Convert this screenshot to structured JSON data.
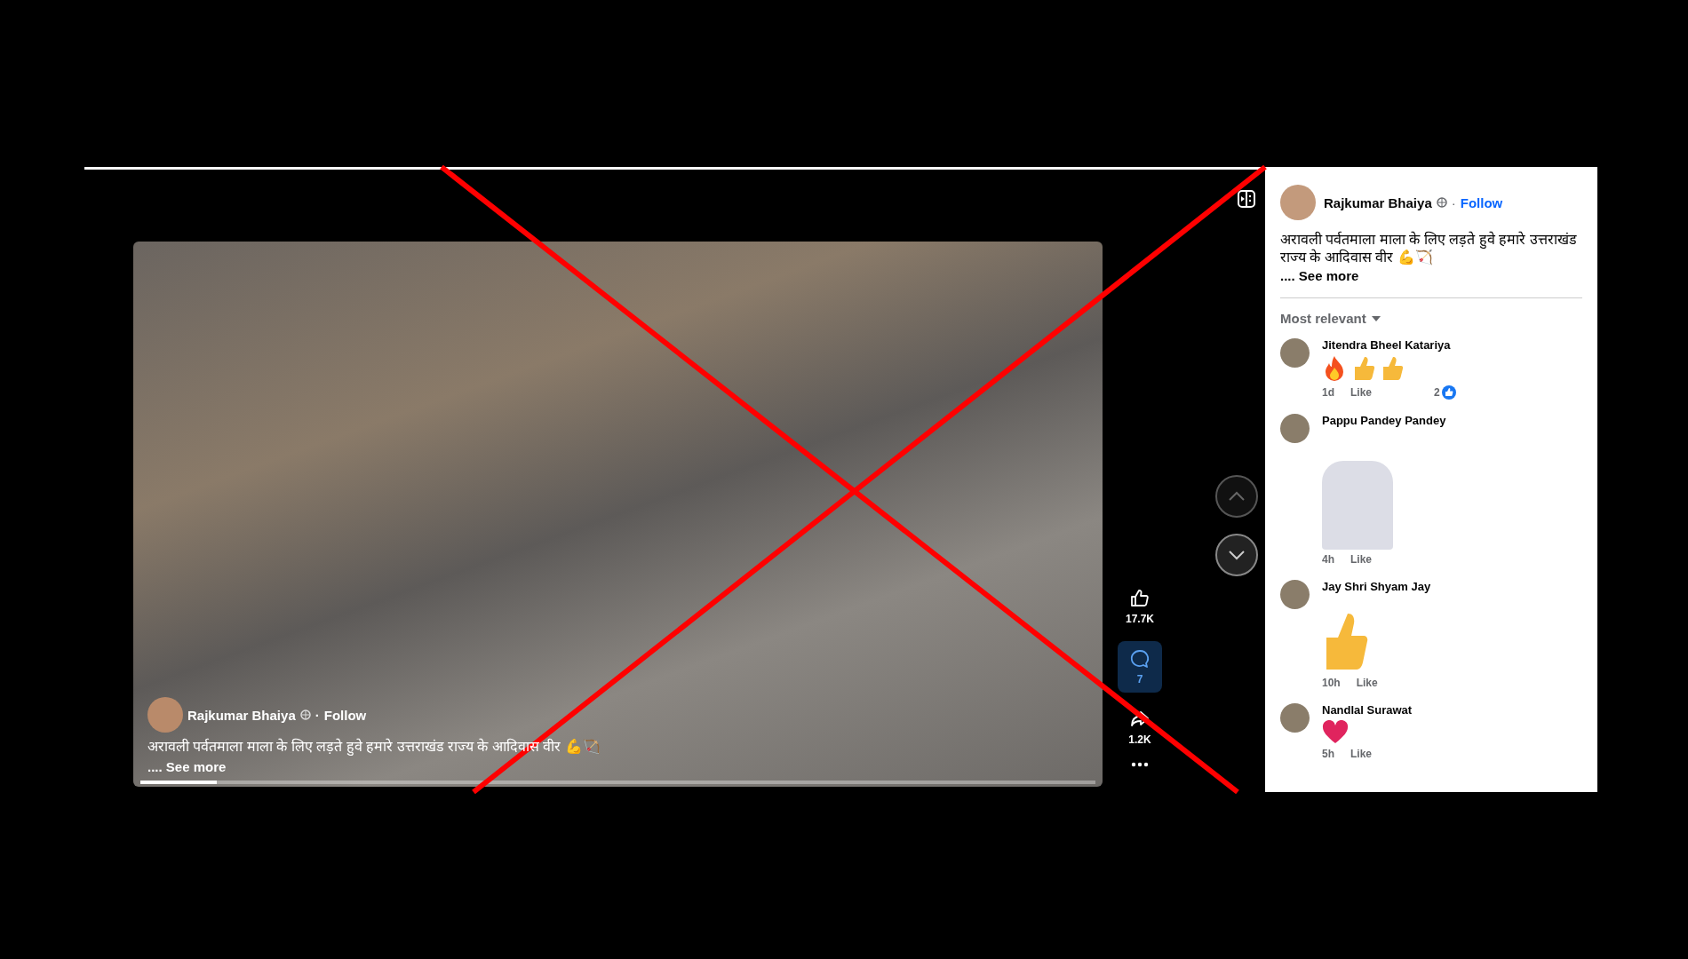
{
  "video": {
    "progress": {
      "level": 0.08
    },
    "author": "Rajkumar Bhaiya",
    "separator": "·",
    "follow": "Follow",
    "caption": "अरावली पर्वतमाला माला के लिए लड़ते हुवे हमारे उत्तराखंड राज्य के आदिवास वीर 💪🏹",
    "see_more": ".... See more"
  },
  "actions": [
    {
      "kind": "like",
      "count": "17.7K",
      "selected": false
    },
    {
      "kind": "comment",
      "count": "7",
      "selected": true
    },
    {
      "kind": "share",
      "count": "1.2K",
      "selected": false
    },
    {
      "kind": "more"
    }
  ],
  "post": {
    "author": "Rajkumar Bhaiya",
    "separator": "·",
    "follow": "Follow",
    "caption": "अरावली पर्वतमाला माला के लिए लड़ते हुवे हमारे उत्तराखंड राज्य के आदिवास वीर 💪🏹",
    "see_more": ".... See more"
  },
  "sort": "Most relevant",
  "comments": [
    {
      "name": "Jitendra Bheel Katariya",
      "content": [
        {
          "kind": "fire"
        },
        {
          "kind": "thumb"
        },
        {
          "kind": "thumb"
        }
      ],
      "time": "1d",
      "like": "Like",
      "reaction_count": "2"
    },
    {
      "name": "Pappu Pandey Pandey",
      "content": [
        {
          "kind": "sticker"
        }
      ],
      "time": "4h",
      "like": "Like"
    },
    {
      "name": "Jay Shri Shyam Jay",
      "content": [
        {
          "kind": "big-thumb"
        }
      ],
      "time": "10h",
      "like": "Like"
    },
    {
      "name": "Nandlal Surawat",
      "content": [
        {
          "kind": "heart"
        }
      ],
      "time": "5h",
      "like": "Like"
    }
  ]
}
